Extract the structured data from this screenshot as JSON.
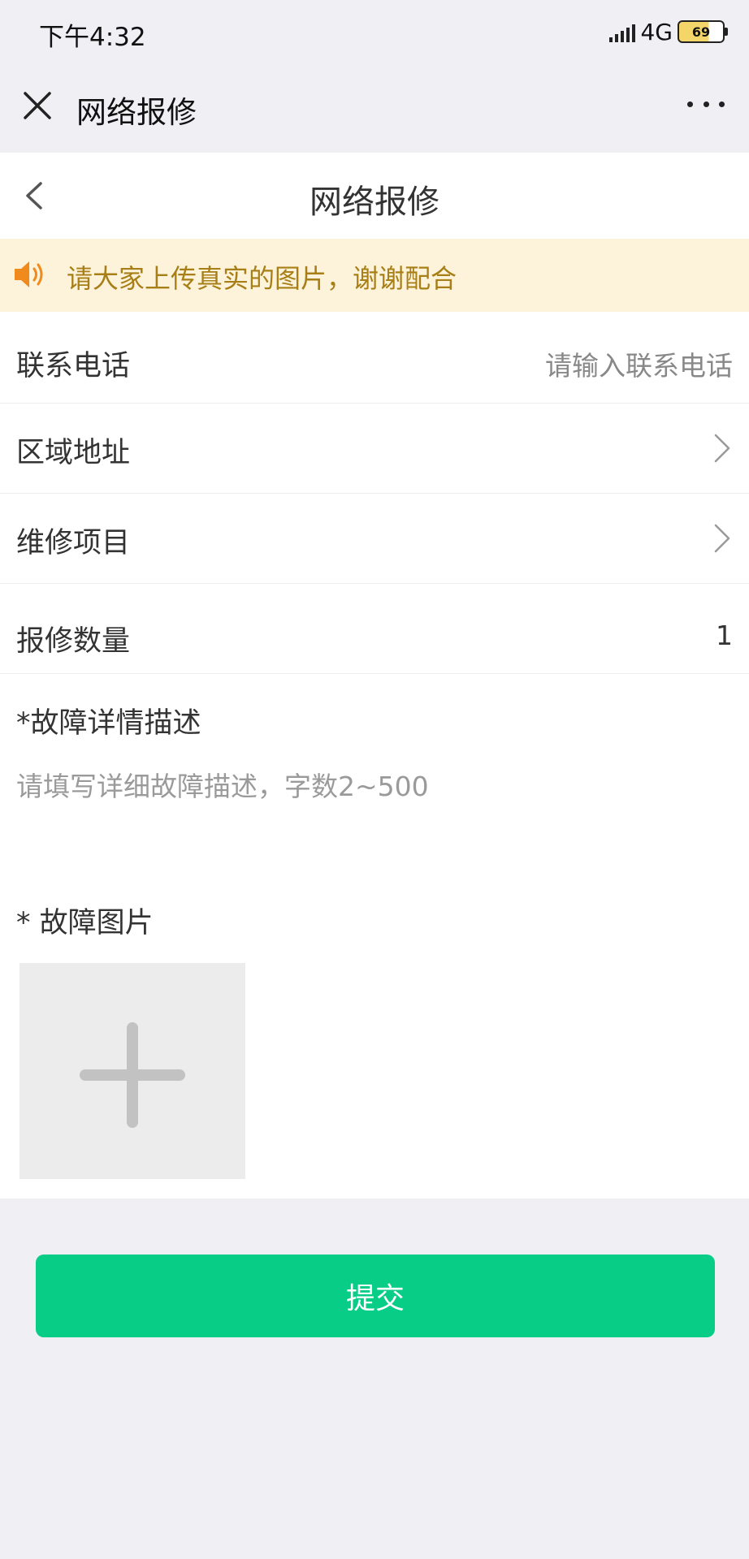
{
  "status_bar": {
    "time": "下午4:32",
    "network": "4G",
    "battery": "69"
  },
  "titlebar": {
    "title": "网络报修"
  },
  "page_header": {
    "title": "网络报修"
  },
  "notice": {
    "text": "请大家上传真实的图片，谢谢配合"
  },
  "form": {
    "phone": {
      "label": "联系电话",
      "placeholder": "请输入联系电话"
    },
    "area": {
      "label": "区域地址"
    },
    "project": {
      "label": "维修项目"
    },
    "quantity": {
      "label": "报修数量",
      "value": "1"
    },
    "description": {
      "label": "*故障详情描述",
      "placeholder": "请填写详细故障描述，字数2~500"
    },
    "pictures": {
      "label": "* 故障图片"
    }
  },
  "submit_label": "提交",
  "colors": {
    "accent": "#07cd86",
    "notice_bg": "#fdf3da",
    "notice_text": "#a87f16"
  }
}
